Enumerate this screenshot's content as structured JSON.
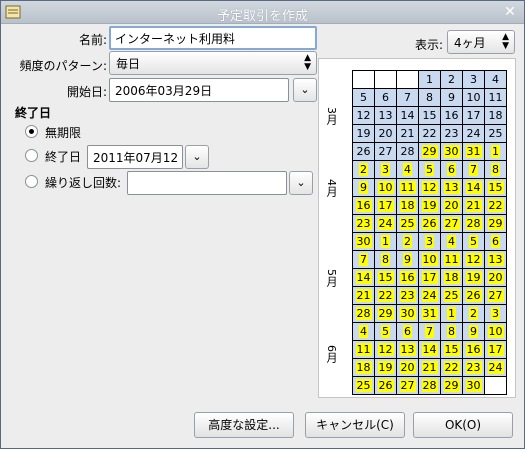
{
  "window": {
    "title": "予定取引を作成"
  },
  "form": {
    "name_label": "名前:",
    "name_value": "インターネット利用料",
    "freq_label": "頻度のパターン:",
    "freq_value": "毎日",
    "start_label": "開始日:",
    "start_value": "2006年03月29日",
    "end_section": "終了日",
    "end_options": [
      "無期限",
      "終了日",
      "繰り返し回数:"
    ],
    "end_date_value": "2011年07月12",
    "count_value": ""
  },
  "display": {
    "label": "表示:",
    "value": "4ヶ月"
  },
  "calendar": {
    "months": [
      "3月",
      "4月",
      "5月",
      "6月"
    ],
    "rows": [
      [
        "",
        "",
        "",
        "",
        "1",
        "2",
        "3",
        "4"
      ],
      [
        "5",
        "6",
        "7",
        "8",
        "9",
        "10",
        "11"
      ],
      [
        "12",
        "13",
        "14",
        "15",
        "16",
        "17",
        "18"
      ],
      [
        "19",
        "20",
        "21",
        "22",
        "23",
        "24",
        "25"
      ],
      [
        "26",
        "27",
        "28",
        "29",
        "30",
        "31",
        "1"
      ],
      [
        "2",
        "3",
        "4",
        "5",
        "6",
        "7",
        "8"
      ],
      [
        "9",
        "10",
        "11",
        "12",
        "13",
        "14",
        "15"
      ],
      [
        "16",
        "17",
        "18",
        "19",
        "20",
        "21",
        "22"
      ],
      [
        "23",
        "24",
        "25",
        "26",
        "27",
        "28",
        "29"
      ],
      [
        "30",
        "1",
        "2",
        "3",
        "4",
        "5",
        "6"
      ],
      [
        "7",
        "8",
        "9",
        "10",
        "11",
        "12",
        "13"
      ],
      [
        "14",
        "15",
        "16",
        "17",
        "18",
        "19",
        "20"
      ],
      [
        "21",
        "22",
        "23",
        "24",
        "25",
        "26",
        "27"
      ],
      [
        "28",
        "29",
        "30",
        "31",
        "1",
        "2",
        "3"
      ],
      [
        "4",
        "5",
        "6",
        "7",
        "8",
        "9",
        "10"
      ],
      [
        "11",
        "12",
        "13",
        "14",
        "15",
        "16",
        "17"
      ],
      [
        "18",
        "19",
        "20",
        "21",
        "22",
        "23",
        "24"
      ],
      [
        "25",
        "26",
        "27",
        "28",
        "29",
        "30",
        ""
      ]
    ]
  },
  "buttons": {
    "advanced": "高度な設定...",
    "cancel": "キャンセル(C)",
    "ok": "OK(O)"
  },
  "colors": {
    "highlight": "#ffff00",
    "week_bg": "#c9d9f0"
  }
}
